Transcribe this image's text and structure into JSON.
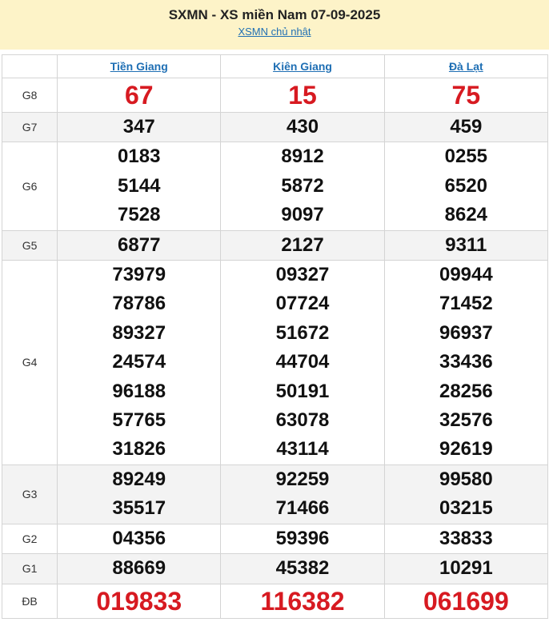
{
  "header": {
    "title": "SXMN - XS miền Nam 07-09-2025",
    "sub_link": "XSMN chủ nhật"
  },
  "provinces": [
    "Tiền Giang",
    "Kiên Giang",
    "Đà Lạt"
  ],
  "prizes": [
    {
      "label": "G8",
      "shade": false,
      "red": true,
      "big": true,
      "values": [
        [
          "67"
        ],
        [
          "15"
        ],
        [
          "75"
        ]
      ]
    },
    {
      "label": "G7",
      "shade": true,
      "red": false,
      "big": false,
      "values": [
        [
          "347"
        ],
        [
          "430"
        ],
        [
          "459"
        ]
      ]
    },
    {
      "label": "G6",
      "shade": false,
      "red": false,
      "big": false,
      "values": [
        [
          "0183",
          "5144",
          "7528"
        ],
        [
          "8912",
          "5872",
          "9097"
        ],
        [
          "0255",
          "6520",
          "8624"
        ]
      ]
    },
    {
      "label": "G5",
      "shade": true,
      "red": false,
      "big": false,
      "values": [
        [
          "6877"
        ],
        [
          "2127"
        ],
        [
          "9311"
        ]
      ]
    },
    {
      "label": "G4",
      "shade": false,
      "red": false,
      "big": false,
      "values": [
        [
          "73979",
          "78786",
          "89327",
          "24574",
          "96188",
          "57765",
          "31826"
        ],
        [
          "09327",
          "07724",
          "51672",
          "44704",
          "50191",
          "63078",
          "43114"
        ],
        [
          "09944",
          "71452",
          "96937",
          "33436",
          "28256",
          "32576",
          "92619"
        ]
      ]
    },
    {
      "label": "G3",
      "shade": true,
      "red": false,
      "big": false,
      "values": [
        [
          "89249",
          "35517"
        ],
        [
          "92259",
          "71466"
        ],
        [
          "99580",
          "03215"
        ]
      ]
    },
    {
      "label": "G2",
      "shade": false,
      "red": false,
      "big": false,
      "values": [
        [
          "04356"
        ],
        [
          "59396"
        ],
        [
          "33833"
        ]
      ]
    },
    {
      "label": "G1",
      "shade": true,
      "red": false,
      "big": false,
      "values": [
        [
          "88669"
        ],
        [
          "45382"
        ],
        [
          "10291"
        ]
      ]
    },
    {
      "label": "ĐB",
      "shade": false,
      "red": true,
      "big": true,
      "values": [
        [
          "019833"
        ],
        [
          "116382"
        ],
        [
          "061699"
        ]
      ]
    }
  ]
}
